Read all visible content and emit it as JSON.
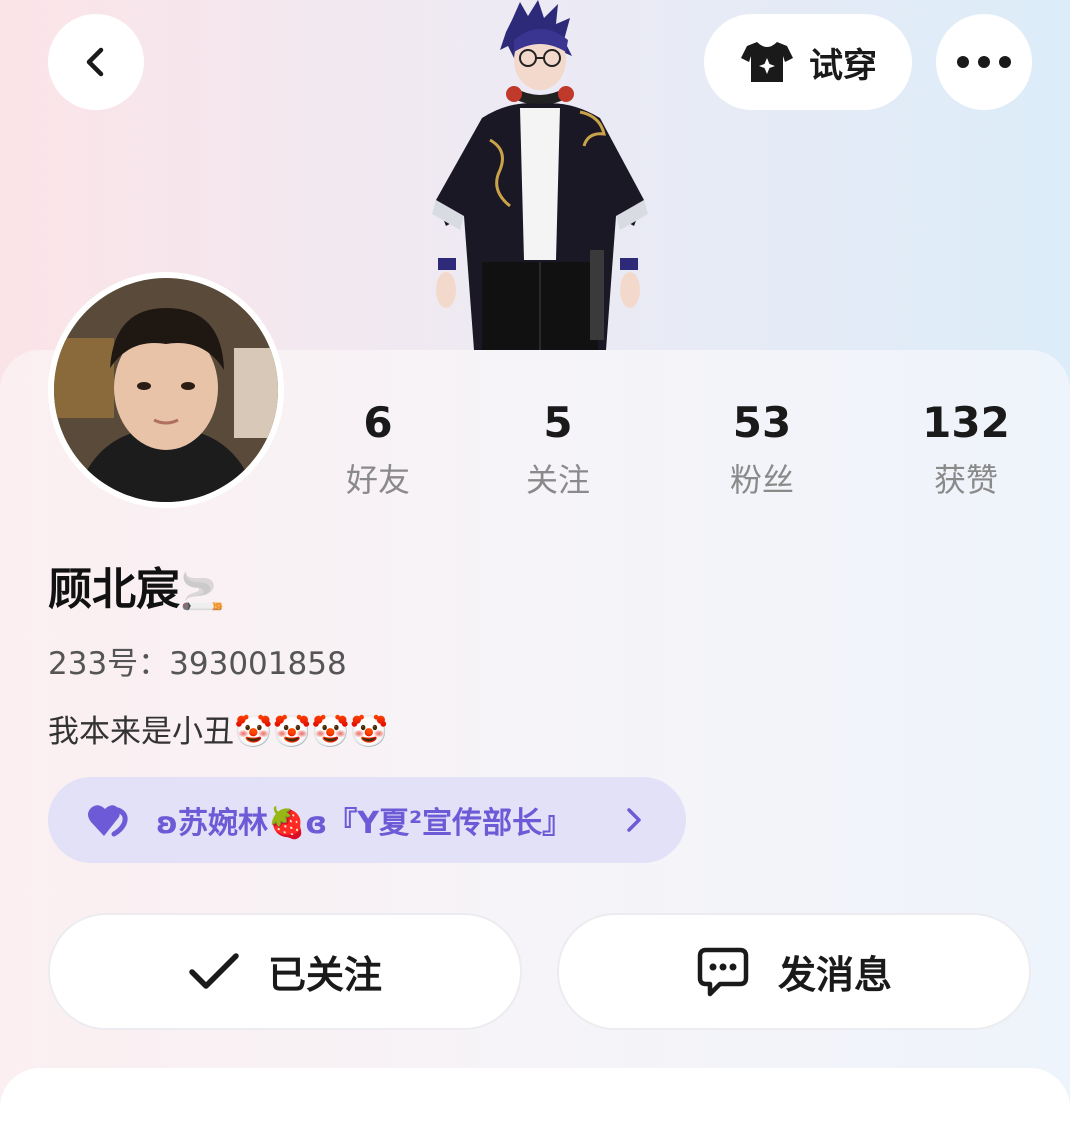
{
  "colors": {
    "accent": "#6c5ad6",
    "pill_bg": "#e3e1f7",
    "stat_label": "#8a8a8a"
  },
  "header": {
    "back_icon": "chevron-left-icon",
    "try_on_label": "试穿",
    "try_on_icon": "tshirt-sparkle-icon",
    "more_icon": "more-dots-icon"
  },
  "profile": {
    "stats": [
      {
        "value": "6",
        "label": "好友"
      },
      {
        "value": "5",
        "label": "关注"
      },
      {
        "value": "53",
        "label": "粉丝"
      },
      {
        "value": "132",
        "label": "获赞"
      }
    ],
    "username": "顾北宸",
    "username_emoji": "🚬",
    "id_text": "233号：393001858",
    "bio": "我本来是小丑🤡🤡🤡🤡",
    "relationship_text": "ʚ苏婉林🍓ɞ『Y夏²宣传部长』",
    "relationship_icon": "heart-icon"
  },
  "actions": {
    "followed_label": "已关注",
    "message_label": "发消息"
  }
}
